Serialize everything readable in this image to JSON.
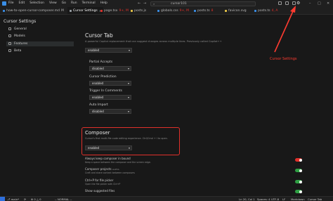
{
  "titlebar": {
    "menus": [
      "File",
      "Edit",
      "Selection",
      "View",
      "Go",
      "Run",
      "Terminal",
      "Help"
    ],
    "command_center": "cursor101",
    "back_icon": "arrow-left-icon",
    "forward_icon": "arrow-right-icon"
  },
  "tabs": [
    {
      "label": "how-to-open-cursor-composer.md",
      "badge": "M",
      "color": "#3a8ee6"
    },
    {
      "label": "Cursor Settings",
      "badge": "",
      "color": "#9aa0a6",
      "active": true
    },
    {
      "label": "page.tsx",
      "badge": "9+, M",
      "color": "#e0302a"
    },
    {
      "label": "posts.js",
      "badge": "",
      "color": "#e8c547"
    },
    {
      "label": "globals.css",
      "badge": "9+, M",
      "color": "#3a8ee6"
    },
    {
      "label": "posts.ts",
      "badge": "8",
      "color": "#3a8ee6"
    },
    {
      "label": "favicon.svg",
      "badge": "",
      "color": "#e8c547"
    },
    {
      "label": "posts.ts",
      "badge": "4, A",
      "color": "#3a8ee6"
    }
  ],
  "sidebar": {
    "title": "Cursor Settings",
    "items": [
      {
        "label": "General",
        "icon": "gear-icon"
      },
      {
        "label": "Models",
        "icon": "cube-icon"
      },
      {
        "label": "Features",
        "icon": "grid-icon",
        "active": true
      },
      {
        "label": "Beta",
        "icon": "flask-icon"
      }
    ]
  },
  "cursor_tab": {
    "title": "Cursor Tab",
    "description": "A powerful Copilot replacement that can suggest changes across multiple lines. Previously called Copilot++",
    "value": "enabled",
    "fields": [
      {
        "label": "Partial Accepts",
        "value": "disabled"
      },
      {
        "label": "Cursor Prediction",
        "value": "enabled"
      },
      {
        "label": "Trigger In Comments",
        "value": "enabled"
      },
      {
        "label": "Auto Import",
        "value": "disabled"
      }
    ]
  },
  "composer": {
    "title": "Composer",
    "description": "Cursor's first multi-file code editing experience. Ctrl/Cmd + I to open.",
    "value": "enabled",
    "toggles": [
      {
        "label": "Always keep composer in bound",
        "description": "Keep a space between the composer and the screen edge.",
        "on": false
      },
      {
        "label": "Composer projects",
        "badge": "ALPHA",
        "description": "Craft and share context between composers",
        "on": true
      },
      {
        "label": "Ctrl+P for file picker",
        "description": "Open the file picker with Ctrl+P",
        "on": true
      },
      {
        "label": "Show suggested files",
        "description": "",
        "on": true
      }
    ]
  },
  "annotation": {
    "text": "Cursor Settings",
    "color": "#ff3b30"
  },
  "statusbar": {
    "branch": "main*",
    "sync": "⟳",
    "errors": "⊗ 0 △ 0",
    "mode": "-- NORMAL --",
    "position": "Ln 20, Col 1",
    "spaces": "Spaces: 4",
    "encoding": "UTF-8",
    "eol": "LF",
    "language": "Markdown",
    "tab": "Cursor Tab"
  },
  "colors": {
    "accent": "#2f6fdc",
    "highlight": "#e0302a",
    "toggle_on": "#2ea043"
  }
}
